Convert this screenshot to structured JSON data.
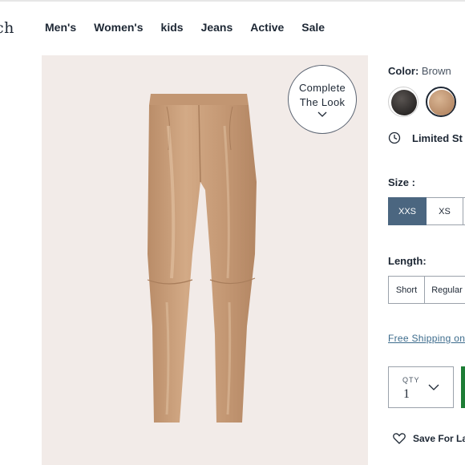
{
  "header": {
    "logo_text": "ch",
    "nav": [
      "Men's",
      "Women's",
      "kids",
      "Jeans",
      "Active",
      "Sale"
    ]
  },
  "product_image": {
    "complete_look_line1": "Complete",
    "complete_look_line2": "The Look",
    "pants_color": "#c69a76"
  },
  "options": {
    "color_label": "Color:",
    "color_value": "Brown",
    "swatches": [
      {
        "name": "Black",
        "hex": "#3a3634"
      },
      {
        "name": "Brown",
        "hex": "#c79e7b",
        "selected": true
      }
    ],
    "stock_text": "Limited St",
    "size_label": "Size :",
    "sizes": [
      "XXS",
      "XS",
      ""
    ],
    "selected_size": "XXS",
    "length_label": "Length:",
    "lengths": [
      "Short",
      "Regular"
    ],
    "shipping_link": "Free Shipping on",
    "qty_label": "QTY",
    "qty_value": "1",
    "save_text": "Save For La",
    "accent_color": "#4b6680",
    "add_button_color": "#1d7d35"
  }
}
